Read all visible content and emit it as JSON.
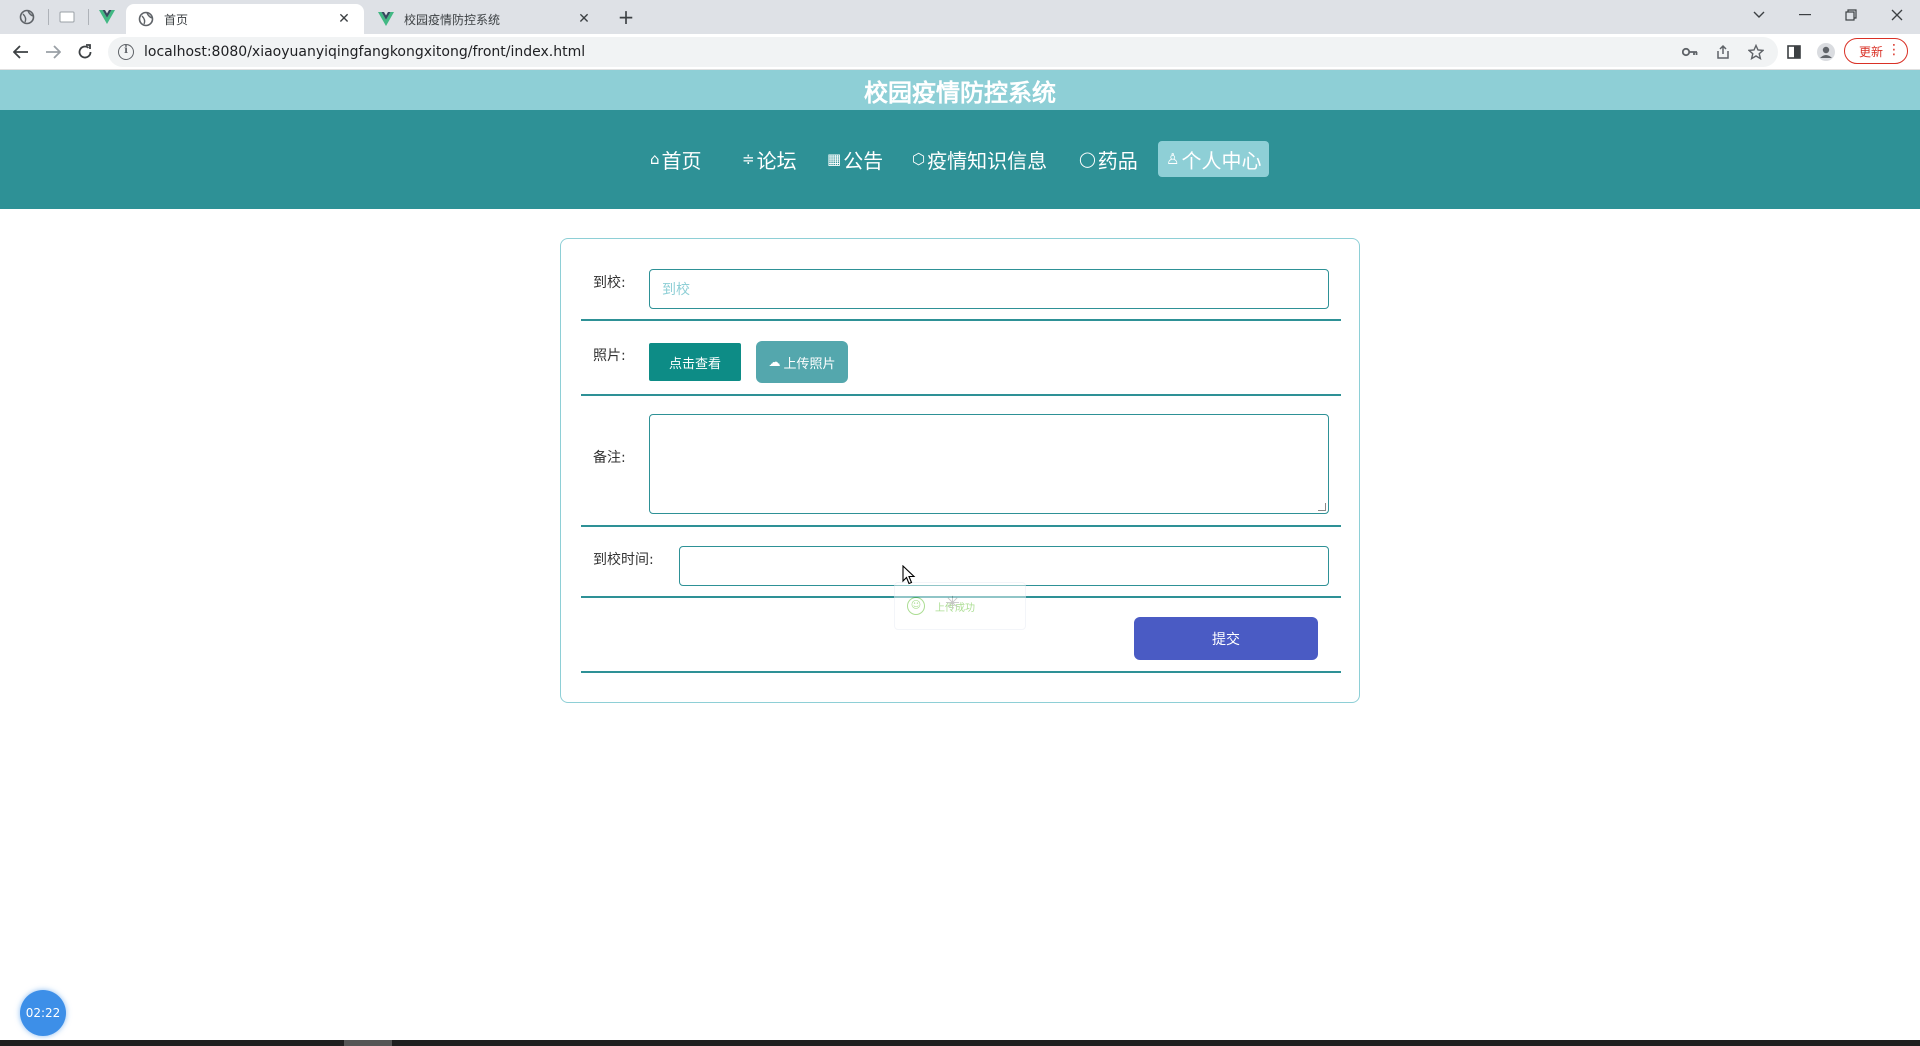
{
  "browser": {
    "tabs": [
      {
        "title": "首页",
        "active": true,
        "favicon": "globe-icon"
      },
      {
        "title": "校园疫情防控系统",
        "active": false,
        "favicon": "vue-icon"
      }
    ],
    "pinned_tabs": [
      "globe-icon",
      "blank-page-icon",
      "vue-icon"
    ],
    "new_tab_label": "+",
    "address": "localhost:8080/xiaoyuanyiqingfangkongxitong/front/index.html",
    "update_label": "更新",
    "accent_color": "#d93025"
  },
  "site": {
    "title": "校园疫情防控系统",
    "colors": {
      "header": "#8ecfd6",
      "nav": "#2e9196",
      "primary_button": "#0d8c86",
      "submit": "#4a5bc4"
    }
  },
  "nav": {
    "items": [
      {
        "label": "首页",
        "icon": "home-icon",
        "glyph": "⌂"
      },
      {
        "label": "论坛",
        "icon": "sliders-icon",
        "glyph": "≑"
      },
      {
        "label": "公告",
        "icon": "grid-icon",
        "glyph": "▦"
      },
      {
        "label": "疫情知识信息",
        "icon": "cube-icon",
        "glyph": "⬡"
      },
      {
        "label": "药品",
        "icon": "smile-icon",
        "glyph": "◯"
      },
      {
        "label": "个人中心",
        "icon": "user-icon",
        "glyph": "♙",
        "active": true
      }
    ]
  },
  "form": {
    "school_label": "到校:",
    "school_placeholder": "到校",
    "school_value": "",
    "photo_label": "照片:",
    "view_button": "点击查看",
    "upload_button": "上传照片",
    "remark_label": "备注:",
    "remark_value": "",
    "time_label": "到校时间:",
    "time_value": "",
    "submit_button": "提交"
  },
  "toast": {
    "message": "上传成功"
  },
  "timer": {
    "value": "02:22"
  }
}
